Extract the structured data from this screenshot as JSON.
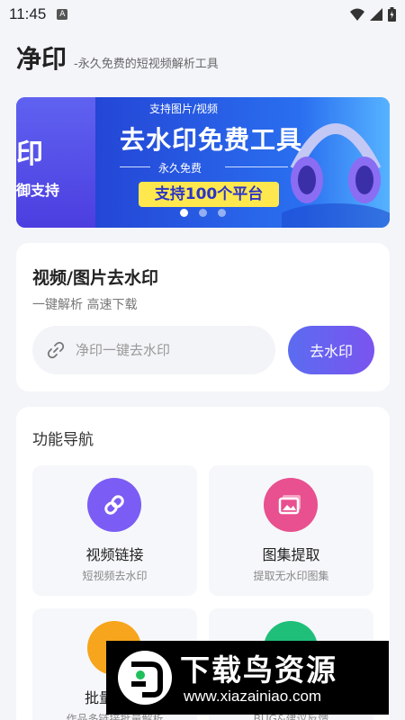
{
  "status_bar": {
    "time": "11:45",
    "notification_badge": "A"
  },
  "header": {
    "title": "净印",
    "subtitle": "-永久免费的短视频解析工具"
  },
  "banner": {
    "left_text_1": "印",
    "left_text_2": "御支持",
    "tag": "支持图片/视频",
    "headline": "去水印免费工具",
    "free_text": "永久免费",
    "pill_text": "支持100个平台",
    "slide_count": 3,
    "active_slide": 1
  },
  "parse_card": {
    "title": "视频/图片去水印",
    "subtitle": "一键解析 高速下载",
    "input_placeholder": "净印一键去水印",
    "input_value": "",
    "button_label": "去水印"
  },
  "features": {
    "title": "功能导航",
    "items": [
      {
        "label": "视频链接",
        "desc": "短视频去水印",
        "icon": "link-icon",
        "color": "#7b5cf5"
      },
      {
        "label": "图集提取",
        "desc": "提取无水印图集",
        "icon": "image-icon",
        "color": "#e8508f"
      },
      {
        "label": "批量",
        "desc": "作品多链接批量解析",
        "icon": "batch-icon",
        "color": "#f7a51c"
      },
      {
        "label": "",
        "desc": "BUG&建议反馈",
        "icon": "feedback-icon",
        "color": "#1fbf7a"
      }
    ]
  },
  "overlay": {
    "title": "下载鸟资源",
    "url": "www.xiazainiao.com"
  },
  "colors": {
    "accent": "#6a5cf0",
    "background": "#f4f5f9"
  }
}
